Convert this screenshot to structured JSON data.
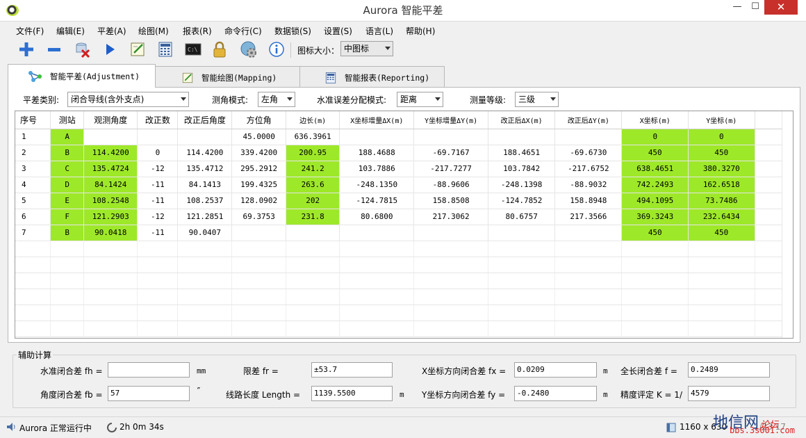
{
  "window": {
    "title": "Aurora 智能平差",
    "minimize": "—",
    "maximize": "☐",
    "close": "✕"
  },
  "menu": [
    "文件(F)",
    "编辑(E)",
    "平差(A)",
    "绘图(M)",
    "报表(R)",
    "命令行(C)",
    "数据锁(S)",
    "设置(S)",
    "语言(L)",
    "帮助(H)"
  ],
  "toolbar": {
    "icons": [
      "add-icon",
      "remove-icon",
      "delete-icon",
      "run-icon",
      "drawing-icon",
      "calculator-icon",
      "terminal-icon",
      "lock-icon",
      "settings-icon",
      "info-icon"
    ],
    "icon_size_label": "图标大小：",
    "icon_size_value": "中图标"
  },
  "tabs": [
    {
      "label": "智能平差(Adjustment)",
      "icon": "network-icon",
      "active": true
    },
    {
      "label": "智能绘图(Mapping)",
      "icon": "drawing-icon",
      "active": false
    },
    {
      "label": "智能报表(Reporting)",
      "icon": "report-icon",
      "active": false
    }
  ],
  "options": {
    "adj_type_label": "平差类别:",
    "adj_type_value": "闭合导线(含外支点)",
    "angle_mode_label": "测角模式:",
    "angle_mode_value": "左角",
    "level_dist_label": "水准误差分配模式:",
    "level_dist_value": "距离",
    "grade_label": "测量等级:",
    "grade_value": "三级"
  },
  "table": {
    "headers": [
      "序号",
      "测站",
      "观测角度",
      "改正数",
      "改正后角度",
      "方位角",
      "边长(m)",
      "X坐标增量ΔX(m)",
      "Y坐标增量ΔY(m)",
      "改正后ΔX(m)",
      "改正后ΔY(m)",
      "X坐标(m)",
      "Y坐标(m)"
    ],
    "rows": [
      [
        "1",
        "A",
        "",
        "",
        "",
        "45.0000",
        "636.3961",
        "",
        "",
        "",
        "",
        "0",
        "0"
      ],
      [
        "2",
        "B",
        "114.4200",
        "0",
        "114.4200",
        "339.4200",
        "200.95",
        "188.4688",
        "-69.7167",
        "188.4651",
        "-69.6730",
        "450",
        "450"
      ],
      [
        "3",
        "C",
        "135.4724",
        "-12",
        "135.4712",
        "295.2912",
        "241.2",
        "103.7886",
        "-217.7277",
        "103.7842",
        "-217.6752",
        "638.4651",
        "380.3270"
      ],
      [
        "4",
        "D",
        "84.1424",
        "-11",
        "84.1413",
        "199.4325",
        "263.6",
        "-248.1350",
        "-88.9606",
        "-248.1398",
        "-88.9032",
        "742.2493",
        "162.6518"
      ],
      [
        "5",
        "E",
        "108.2548",
        "-11",
        "108.2537",
        "128.0902",
        "202",
        "-124.7815",
        "158.8508",
        "-124.7852",
        "158.8948",
        "494.1095",
        "73.7486"
      ],
      [
        "6",
        "F",
        "121.2903",
        "-12",
        "121.2851",
        "69.3753",
        "231.8",
        "80.6800",
        "217.3062",
        "80.6757",
        "217.3566",
        "369.3243",
        "232.6434"
      ],
      [
        "7",
        "B",
        "90.0418",
        "-11",
        "90.0407",
        "",
        "",
        "",
        "",
        "",
        "",
        "450",
        "450"
      ]
    ]
  },
  "aux": {
    "title": "辅助计算",
    "fh_label": "水准闭合差 fh =",
    "fh_value": "",
    "fh_unit": "mm",
    "fr_label": "限差 fr =",
    "fr_value": "±53.7",
    "fx_label": "X坐标方向闭合差 fx =",
    "fx_value": "0.0209",
    "fx_unit": "m",
    "f_label": "全长闭合差 f =",
    "f_value": "0.2489",
    "fb_label": "角度闭合差 fb =",
    "fb_value": "57",
    "fb_unit": "″",
    "length_label": "线路长度 Length =",
    "length_value": "1139.5500",
    "length_unit": "m",
    "fy_label": "Y坐标方向闭合差 fy =",
    "fy_value": "-0.2480",
    "fy_unit": "m",
    "k_label": "精度评定 K = 1/",
    "k_value": "4579"
  },
  "status": {
    "running": "Aurora 正常运行中",
    "uptime": "2h 0m 34s",
    "resolution": "1160 x 630",
    "extra": "1/23 17"
  },
  "watermark": {
    "main": "地信网",
    "sub": "论坛",
    "url": "bbs.3s001.com"
  }
}
